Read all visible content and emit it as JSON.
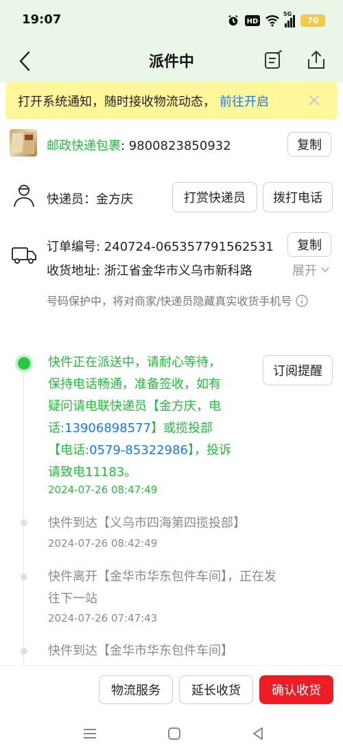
{
  "status_bar": {
    "time": "19:07",
    "icons": [
      "alarm-icon",
      "hd-icon",
      "wifi-icon",
      "signal-icon"
    ],
    "signal_label": "5G",
    "battery": "70",
    "battery_color": "#f2c94c"
  },
  "header": {
    "title": "派件中",
    "back_icon": "chevron-left-icon",
    "edit_icon": "edit-icon",
    "share_icon": "share-icon"
  },
  "notice": {
    "text": "打开系统通知，随时接收物流动态，",
    "link": "前往开启",
    "bg_color": "#fff79a"
  },
  "package": {
    "carrier": "邮政快递包裹",
    "separator": ": ",
    "tracking_number": "9800823850932",
    "copy_label": "复制"
  },
  "courier": {
    "label": "快递员：金方庆",
    "tip_button": "打赏快递员",
    "call_button": "拨打电话"
  },
  "order": {
    "number_line": "订单编号: 240724-065357791562531",
    "copy_label": "复制",
    "address_line": "收货地址: 浙江省金华市义乌市新科路",
    "expand_label": "展开",
    "privacy_text": "号码保护中，将对商家/快递员隐藏真实收货手机号"
  },
  "timeline": {
    "subscribe_button": "订阅提醒",
    "accent_color": "#28c840",
    "events": [
      {
        "text_lines": [
          "快件正在派送中，请耐心等待，",
          "保持电话畅通，准备签收，如有",
          "疑问请电联快递员【金方庆，电",
          "话:",
          "13906898577",
          "】或揽投部",
          "【电话:",
          "0579-85322986",
          "】，投诉",
          "请致电11183。"
        ],
        "time": "2024-07-26 08:47:49"
      },
      {
        "text": "快件到达【义乌市四海第四揽投部】",
        "time": "2024-07-26 08:42:49"
      },
      {
        "text_line1": "快件离开【金华市华东包件车间】，正在发",
        "text_line2": "往下一站",
        "time": "2024-07-26 07:47:43"
      },
      {
        "text": "快件到达【金华市华东包件车间】"
      }
    ]
  },
  "bottom_bar": {
    "logistics_button": "物流服务",
    "extend_button": "延长收货",
    "confirm_button": "确认收货",
    "confirm_color": "#ee1c25"
  },
  "nav_bar": {
    "icons": [
      "menu-icon",
      "home-icon",
      "back-icon"
    ]
  }
}
